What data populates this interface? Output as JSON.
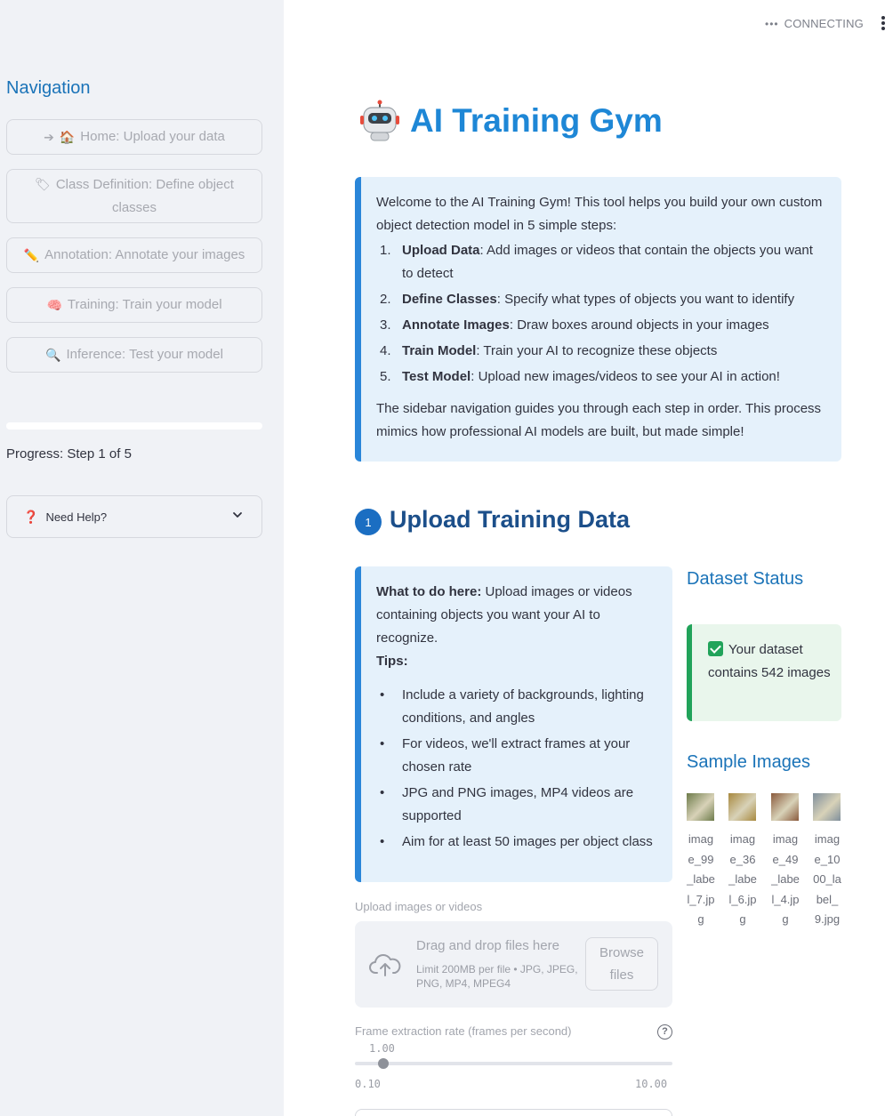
{
  "sidebar": {
    "title": "Navigation",
    "items": [
      {
        "icon": "arrow-right-icon",
        "glyph": "➔",
        "emoji": "🏠",
        "label": "Home: Upload your data"
      },
      {
        "icon": "tag-icon",
        "glyph": "🏷",
        "label": "Class Definition: Define object classes"
      },
      {
        "icon": "pencil-icon",
        "glyph": "✏️",
        "label": "Annotation: Annotate your images"
      },
      {
        "icon": "brain-icon",
        "glyph": "🧠",
        "label": "Training: Train your model"
      },
      {
        "icon": "magnifier-icon",
        "glyph": "🔍",
        "label": "Inference: Test your model"
      }
    ],
    "progress": {
      "fraction": 0.2,
      "text": "Progress: Step 1 of 5"
    },
    "help": {
      "label": "Need Help?",
      "glyph": "❓"
    }
  },
  "topbar": {
    "status": "CONNECTING",
    "dots": "•••"
  },
  "header": {
    "title": "AI Training Gym"
  },
  "welcome": {
    "intro": "Welcome to the AI Training Gym! This tool helps you build your own custom object detection model in 5 simple steps:",
    "steps": [
      {
        "num": "1.",
        "bold": "Upload Data",
        "text": ": Add images or videos that contain the objects you want to detect"
      },
      {
        "num": "2.",
        "bold": "Define Classes",
        "text": ": Specify what types of objects you want to identify"
      },
      {
        "num": "3.",
        "bold": "Annotate Images",
        "text": ": Draw boxes around objects in your images"
      },
      {
        "num": "4.",
        "bold": "Train Model",
        "text": ": Train your AI to recognize these objects"
      },
      {
        "num": "5.",
        "bold": "Test Model",
        "text": ": Upload new images/videos to see your AI in action!"
      }
    ],
    "outro": "The sidebar navigation guides you through each step in order. This process mimics how professional AI models are built, but made simple!"
  },
  "section": {
    "number": "1",
    "title": "Upload Training Data"
  },
  "todo": {
    "lead_bold": "What to do here:",
    "lead_text": " Upload images or videos containing objects you want your AI to recognize.",
    "tips_label": "Tips:",
    "tips": [
      "Include a variety of backgrounds, lighting conditions, and angles",
      "For videos, we'll extract frames at your chosen rate",
      "JPG and PNG images, MP4 videos are supported",
      "Aim for at least 50 images per object class"
    ]
  },
  "dataset": {
    "title": "Dataset Status",
    "message": "Your dataset contains 542 images"
  },
  "samples": {
    "title": "Sample Images",
    "images": [
      {
        "label": "image_99_label_7.jpg",
        "color": "#6d7b4a"
      },
      {
        "label": "image_36_label_6.jpg",
        "color": "#a8893f"
      },
      {
        "label": "image_49_label_4.jpg",
        "color": "#8a5a3c"
      },
      {
        "label": "image_1000_label_9.jpg",
        "color": "#7f8f9c"
      }
    ]
  },
  "uploader": {
    "label": "Upload images or videos",
    "main": "Drag and drop files here",
    "sub": "Limit 200MB per file • JPG, JPEG, PNG, MP4, MPEG4",
    "browse": "Browse files"
  },
  "slider": {
    "label": "Frame extraction rate (frames per second)",
    "value": "1.00",
    "min": "0.10",
    "max": "10.00",
    "fraction": 0.091
  }
}
